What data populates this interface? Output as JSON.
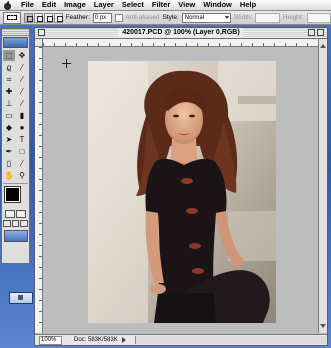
{
  "menubar": {
    "items": [
      "File",
      "Edit",
      "Image",
      "Layer",
      "Select",
      "Filter",
      "View",
      "Window",
      "Help"
    ]
  },
  "options_bar": {
    "feather_label": "Feather:",
    "feather_value": "0 px",
    "antialiased_label": "Anti-aliased",
    "style_label": "Style:",
    "style_value": "Normal",
    "width_label": "Width:",
    "height_label": "Height:"
  },
  "toolbox": {
    "tools": [
      {
        "icon": "marquee-icon",
        "glyph": "⬚"
      },
      {
        "icon": "move-icon",
        "glyph": "✥"
      },
      {
        "icon": "lasso-icon",
        "glyph": "ϱ"
      },
      {
        "icon": "magic-wand-icon",
        "glyph": "⁄"
      },
      {
        "icon": "crop-icon",
        "glyph": "⌗"
      },
      {
        "icon": "slice-icon",
        "glyph": "⁄"
      },
      {
        "icon": "healing-brush-icon",
        "glyph": "✚"
      },
      {
        "icon": "brush-icon",
        "glyph": "⁄"
      },
      {
        "icon": "clone-stamp-icon",
        "glyph": "⊥"
      },
      {
        "icon": "history-brush-icon",
        "glyph": "⁄"
      },
      {
        "icon": "eraser-icon",
        "glyph": "▭"
      },
      {
        "icon": "gradient-icon",
        "glyph": "▮"
      },
      {
        "icon": "blur-icon",
        "glyph": "◆"
      },
      {
        "icon": "dodge-icon",
        "glyph": "●"
      },
      {
        "icon": "path-selection-icon",
        "glyph": "➤"
      },
      {
        "icon": "type-icon",
        "glyph": "T"
      },
      {
        "icon": "pen-icon",
        "glyph": "✒"
      },
      {
        "icon": "shape-icon",
        "glyph": "□"
      },
      {
        "icon": "notes-icon",
        "glyph": "▯"
      },
      {
        "icon": "eyedropper-icon",
        "glyph": "⁄"
      },
      {
        "icon": "hand-icon",
        "glyph": "✋"
      },
      {
        "icon": "zoom-icon",
        "glyph": "⚲"
      }
    ]
  },
  "document": {
    "title": "420017.PCD @ 100% (Layer 0,RGB)",
    "zoom": "100%",
    "doc_info": "Doc: 583K/583K"
  }
}
